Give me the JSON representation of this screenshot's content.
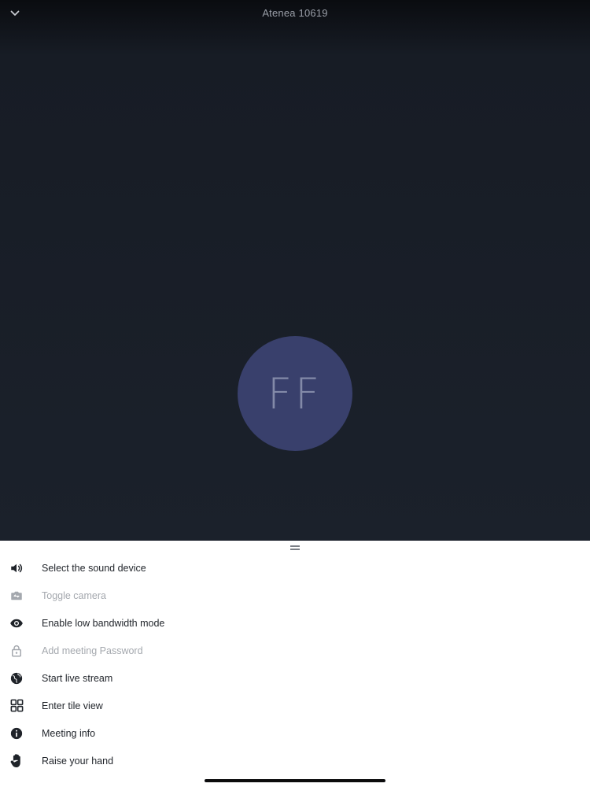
{
  "header": {
    "title": "Atenea 10619",
    "collapse_icon": "chevron-down-icon"
  },
  "participant": {
    "initials": "FF",
    "avatar_color": "#39406c"
  },
  "colors": {
    "stage_background": "#1b212b",
    "sheet_background": "#ffffff",
    "label_enabled": "#1f2329",
    "label_disabled": "#a4a8ae"
  },
  "menu": {
    "items": [
      {
        "label": "Select the sound device",
        "icon": "volume-icon",
        "enabled": true
      },
      {
        "label": "Toggle camera",
        "icon": "switch-camera-icon",
        "enabled": false
      },
      {
        "label": "Enable low bandwidth mode",
        "icon": "eye-icon",
        "enabled": true
      },
      {
        "label": "Add meeting Password",
        "icon": "lock-icon",
        "enabled": false
      },
      {
        "label": "Start live stream",
        "icon": "globe-icon",
        "enabled": true
      },
      {
        "label": "Enter tile view",
        "icon": "tile-grid-icon",
        "enabled": true
      },
      {
        "label": "Meeting info",
        "icon": "info-icon",
        "enabled": true
      },
      {
        "label": "Raise your hand",
        "icon": "hand-icon",
        "enabled": true
      }
    ]
  }
}
